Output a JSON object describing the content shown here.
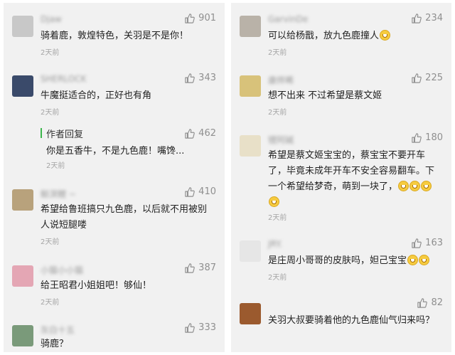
{
  "left": {
    "comments": [
      {
        "name": "Djaw",
        "likes": "901",
        "text": "骑着鹿，敦煌特色，关羽是不是你！",
        "time": "2天前",
        "avatar_color": "#c8c8c8"
      },
      {
        "name": "SHERLOCK",
        "likes": "343",
        "text": "牛魔挺适合的，正好也有角",
        "time": "2天前",
        "avatar_color": "#3a4a6a"
      },
      {
        "name": "鲸溟鲤 ~",
        "likes": "410",
        "text": "希望给鲁班搞只九色鹿，以后就不用被别人说短腿喽",
        "time": "2天前",
        "avatar_color": "#b8a27c"
      },
      {
        "name": "小猫小小猫",
        "likes": "387",
        "text": "给王昭君小姐姐吧！够仙！",
        "time": "2天前",
        "avatar_color": "#e4a6b4"
      },
      {
        "name": "灰白十五",
        "likes": "333",
        "text": "骑鹿？",
        "time": "",
        "avatar_color": "#7a9a7a"
      }
    ],
    "reply": {
      "label": "作者回复",
      "likes": "462",
      "text": "你是五香牛，不是九色鹿！嘴馋...",
      "time": "2天前"
    }
  },
  "right": {
    "comments": [
      {
        "name": "GarvinDe",
        "likes": "234",
        "text": "可以给杨戬，放九色鹿撞人",
        "emojis": 1,
        "time": "2天前",
        "avatar_color": "#b9b2a8"
      },
      {
        "name": "康烨晞",
        "likes": "225",
        "text": "想不出来 不过希望是蔡文姬",
        "emojis": 0,
        "time": "2天前",
        "avatar_color": "#d8c27a"
      },
      {
        "name": "锂阿碱",
        "likes": "180",
        "text": "希望是蔡文姬宝宝的，蔡宝宝不要开车了，毕竟未成年开车不安全容易翻车。下一个希望给梦奇，萌到一块了，",
        "emojis": 4,
        "time": "2天前",
        "avatar_color": "#e8e0c8"
      },
      {
        "name": "JRY.",
        "likes": "163",
        "text": "是庄周小哥哥的皮肤吗，妲己宝宝",
        "emojis": 2,
        "time": "2天前",
        "avatar_color": "#e6e6e6"
      },
      {
        "name": "",
        "likes": "82",
        "text": "关羽大叔要骑着他的九色鹿仙气归来吗？",
        "emojis": 0,
        "time": "",
        "avatar_color": "#9b5a2e"
      }
    ]
  }
}
